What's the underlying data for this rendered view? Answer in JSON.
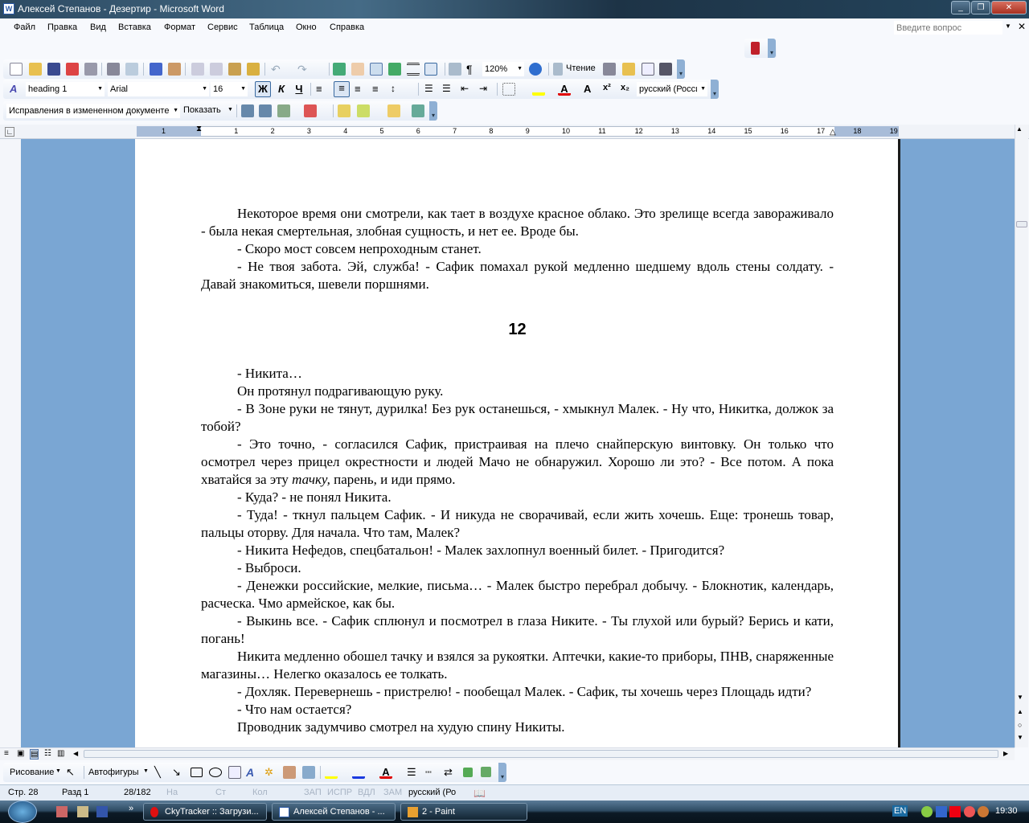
{
  "window": {
    "title": "Алексей Степанов - Дезертир - Microsoft Word",
    "app_icon": "W"
  },
  "menu": {
    "items": [
      "Файл",
      "Правка",
      "Вид",
      "Вставка",
      "Формат",
      "Сервис",
      "Таблица",
      "Окно",
      "Справка"
    ],
    "help_placeholder": "Введите вопрос"
  },
  "toolbar": {
    "zoom": "120%",
    "reading_label": "Чтение",
    "style": "heading 1",
    "font": "Arial",
    "size": "16",
    "bold": "Ж",
    "italic": "К",
    "underline": "Ч",
    "language": "русский (Росси",
    "track_mode": "Исправления в измененном документе",
    "show_label": "Показать"
  },
  "ruler": {
    "marks": [
      "1",
      "1",
      "2",
      "3",
      "4",
      "5",
      "6",
      "7",
      "8",
      "9",
      "10",
      "11",
      "12",
      "13",
      "14",
      "15",
      "16",
      "17",
      "18",
      "19"
    ]
  },
  "document": {
    "paragraphs_before": [
      "Некоторое время они смотрели, как тает в воздухе красное облако. Это зрелище всегда завораживало - была некая смертельная, злобная сущность, и нет ее. Вроде бы.",
      "- Скоро мост совсем непроходным станет.",
      "- Не твоя забота. Эй, служба! - Сафик помахал рукой медленно шедшему вдоль стены солдату. - Давай знакомиться, шевели поршнями."
    ],
    "heading": "12",
    "paragraphs_after": [
      "- Никита…",
      "Он протянул подрагивающую руку.",
      "- В Зоне руки не тянут, дурилка! Без рук останешься, - хмыкнул Малек. - Ну что, Никитка, должок за тобой?",
      "- Это точно, - согласился Сафик, пристраивая на плечо снайперскую винтовку. Он только что осмотрел через прицел окрестности и людей Мачо не обнаружил. Хорошо ли это? - Все потом. А пока хватайся за эту"
    ],
    "italic_word": "тачку,",
    "para_tail": " парень, и иди прямо.",
    "paragraphs_end": [
      "- Куда? - не понял Никита.",
      "- Туда! - ткнул пальцем Сафик. - И никуда не сворачивай, если жить хочешь. Еще: тронешь товар, пальцы оторву. Для начала. Что там, Малек?",
      "- Никита Нефедов, спецбатальон! - Малек захлопнул военный билет. - Пригодится?",
      "- Выброси.",
      "- Денежки российские, мелкие, письма… - Малек быстро перебрал добычу. - Блокнотик, календарь, расческа. Чмо армейское, как бы.",
      "- Выкинь все. - Сафик сплюнул и посмотрел в глаза Никите. - Ты глухой или бурый? Берись и кати, погань!",
      "Никита медленно обошел тачку и взялся за рукоятки. Аптечки, какие-то приборы, ПНВ, снаряженные магазины… Нелегко оказалось ее толкать.",
      "- Дохляк. Перевернешь - пристрелю! - пообещал Малек. - Сафик, ты хочешь через Площадь идти?",
      "- Что нам остается?",
      "Проводник задумчиво смотрел на худую спину Никиты."
    ]
  },
  "drawing": {
    "draw_label": "Рисование",
    "autoshapes_label": "Автофигуры"
  },
  "status": {
    "page": "Стр. 28",
    "section": "Разд 1",
    "pages": "28/182",
    "at": "На",
    "line": "Ст",
    "col": "Кол",
    "rec": "ЗАП",
    "trk": "ИСПР",
    "ext": "ВДЛ",
    "ovr": "ЗАМ",
    "lang": "русский (Ро"
  },
  "taskbar": {
    "tasks": [
      "CkyTracker :: Загрузи...",
      "Алексей Степанов - ...",
      "2 - Paint"
    ],
    "lang": "EN",
    "clock": "19:30"
  },
  "colors": {
    "doc_bg": "#7aa6d3",
    "font_color": "#e00000",
    "highlight": "#ffff00"
  }
}
